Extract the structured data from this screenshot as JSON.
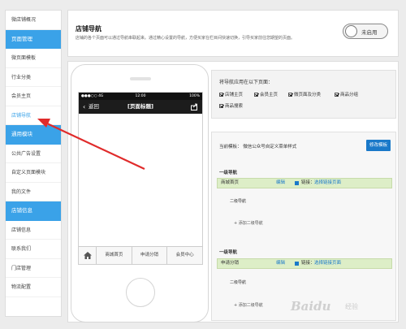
{
  "sidebar": {
    "items": [
      {
        "label": "微店铺概况",
        "type": "item"
      },
      {
        "label": "页面管理",
        "type": "section"
      },
      {
        "label": "微页面模板",
        "type": "item"
      },
      {
        "label": "行业分类",
        "type": "item"
      },
      {
        "label": "会员主页",
        "type": "item"
      },
      {
        "label": "店铺导航",
        "type": "active"
      },
      {
        "label": "通用模块",
        "type": "section"
      },
      {
        "label": "公共广告设置",
        "type": "item"
      },
      {
        "label": "自定义页面模块",
        "type": "item"
      },
      {
        "label": "我的文件",
        "type": "item"
      },
      {
        "label": "店铺信息",
        "type": "section"
      },
      {
        "label": "店铺信息",
        "type": "item"
      },
      {
        "label": "联系我们",
        "type": "item"
      },
      {
        "label": "门店管理",
        "type": "item"
      },
      {
        "label": "物流配置",
        "type": "item"
      }
    ]
  },
  "header": {
    "title": "店铺导航",
    "description": "店铺的各个页面可以通过导航串联起来。通过精心设置的导航，方便买家在栏目间快速切换，引导买家前往您期望的页面。",
    "toggle_label": "未启用"
  },
  "phone": {
    "status": {
      "signal": "●●●○○ 4G",
      "time": "12:00",
      "battery": "100%"
    },
    "nav": {
      "back_label": "返回",
      "title": "[页面标题]"
    },
    "bottom_nav": [
      "商城首页",
      "申请分销",
      "会员中心"
    ]
  },
  "settings": {
    "apply_title": "将导航应用在以下页面：",
    "checkboxes": [
      "店铺主页",
      "会员主页",
      "微页面及分类",
      "商品分组",
      "商品搜索"
    ],
    "template_label": "当前模板：  微信公众号自定义菜单样式",
    "modify_button": "修改模板",
    "menus": [
      {
        "head": "一级导航",
        "name": "商城首页",
        "edit": "编辑",
        "link_label": "链接：",
        "link": "选择链接页面",
        "sub_head": "二级导航",
        "add_sub": "+ 添加二级导航"
      },
      {
        "head": "一级导航",
        "name": "申请分销",
        "edit": "编辑",
        "link_label": "链接：",
        "link": "选择链接页面",
        "sub_head": "二级导航",
        "add_sub": "+ 添加二级导航"
      }
    ]
  },
  "watermark": {
    "brand": "Baidu",
    "sub": "经验"
  },
  "colors": {
    "accent": "#3aa2e8",
    "button": "#1a79c9",
    "menu_row": "#ddeec7",
    "arrow": "#e02b2b"
  }
}
